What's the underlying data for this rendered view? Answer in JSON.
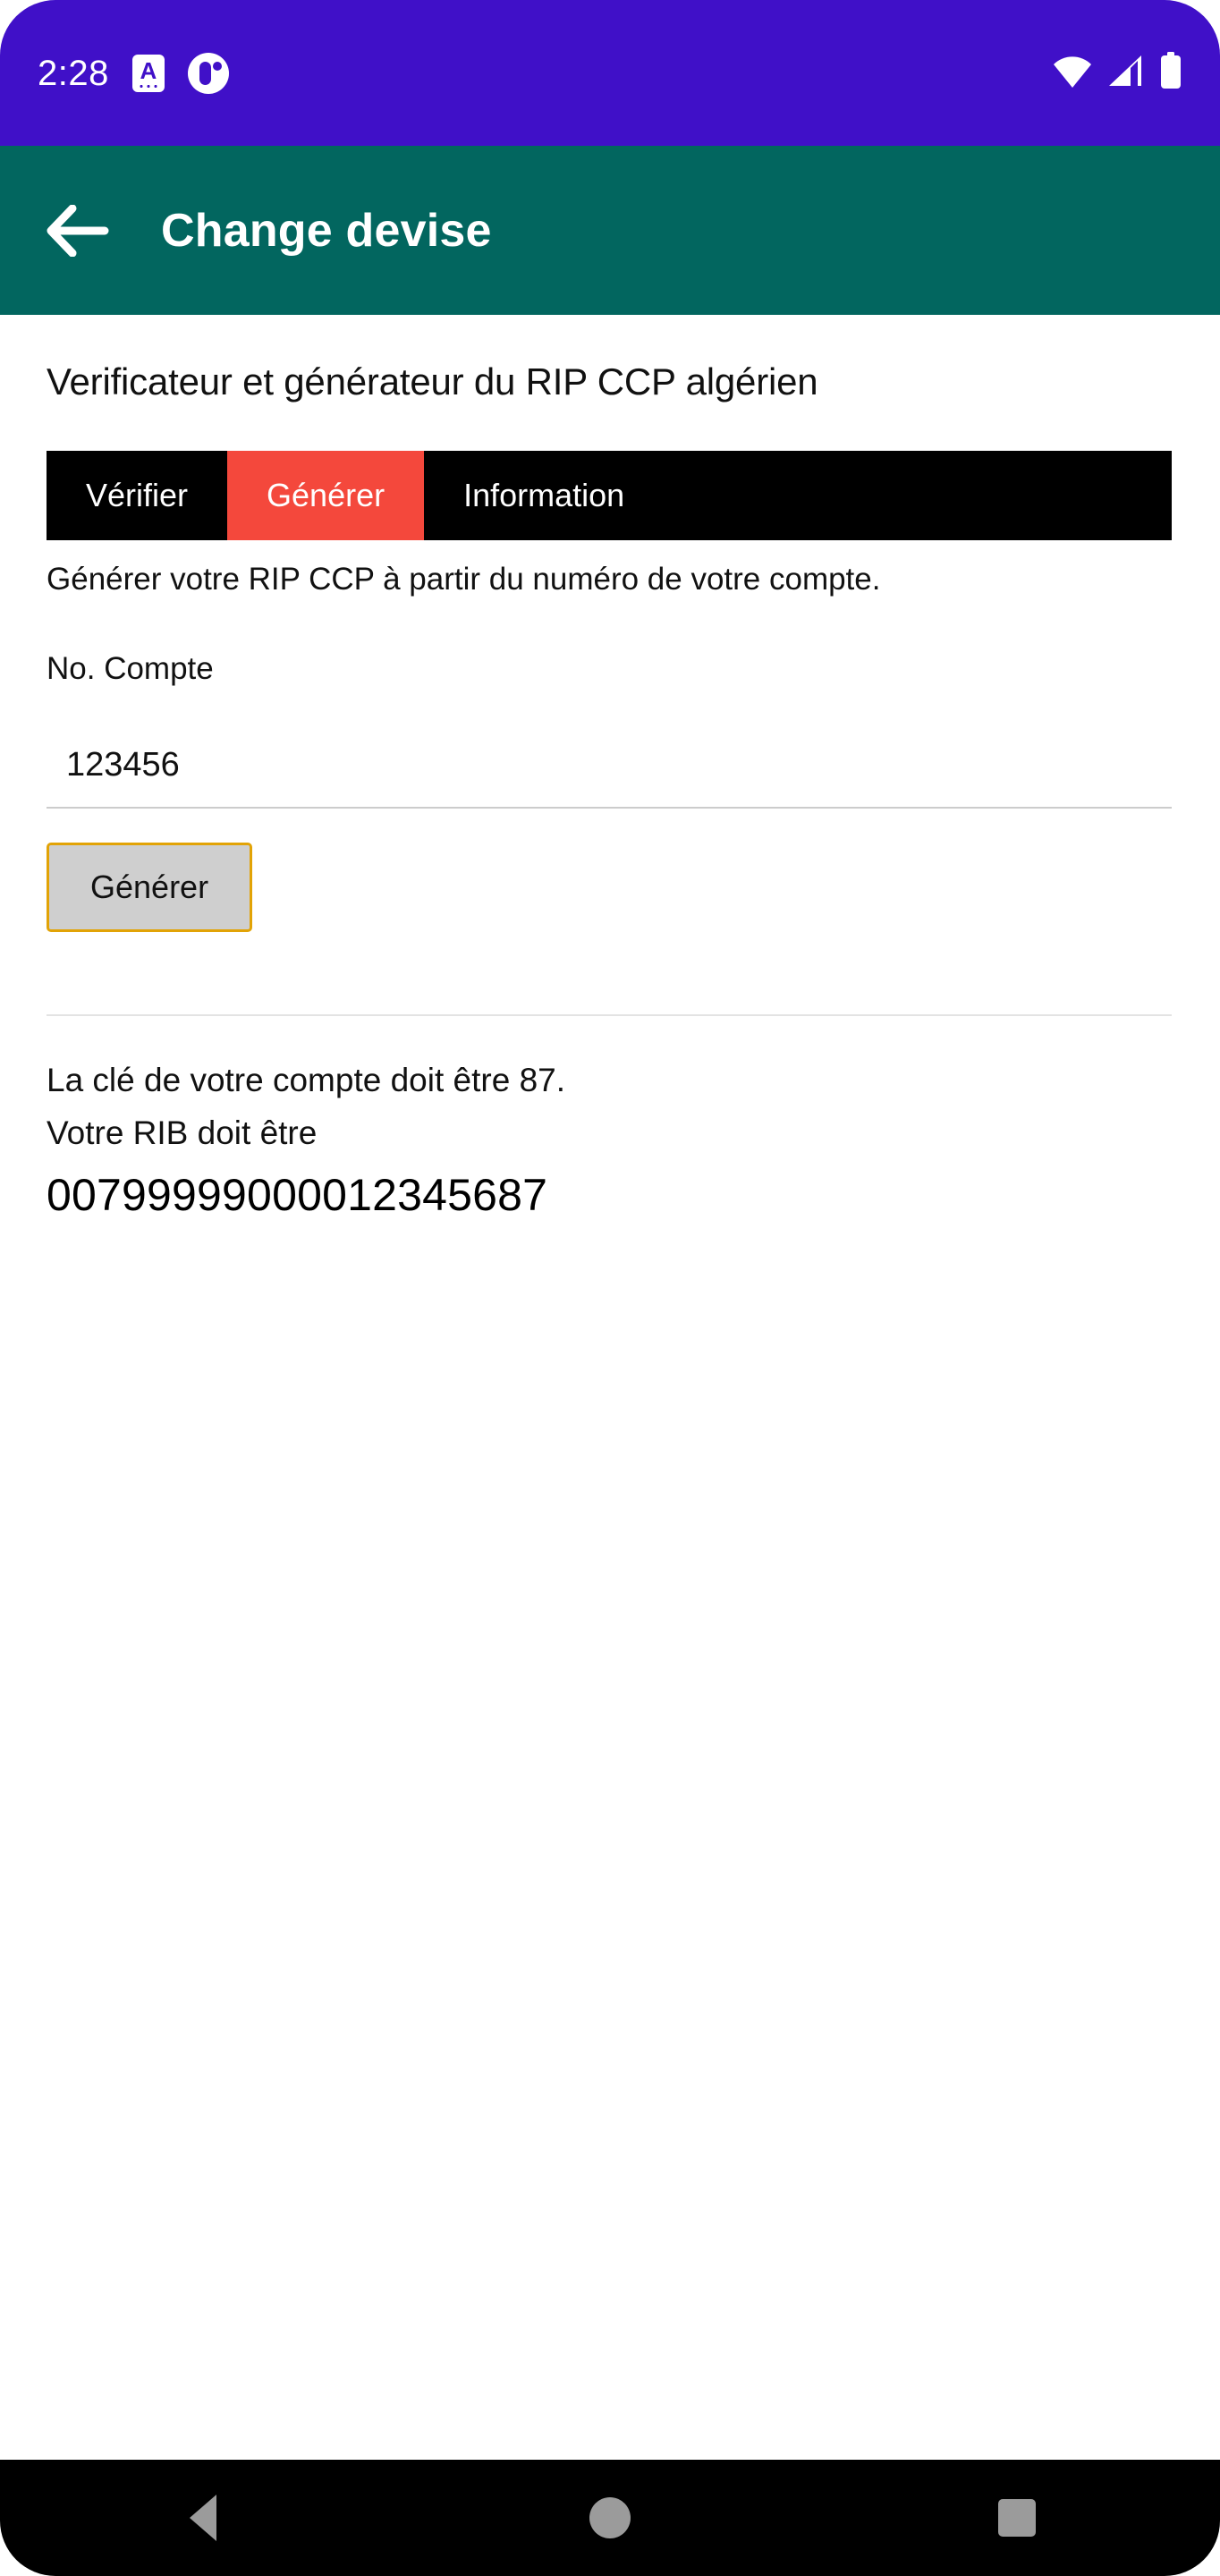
{
  "status_bar": {
    "time": "2:28",
    "left_icons": [
      {
        "name": "language-a-icon",
        "glyph": "A"
      },
      {
        "name": "app-badge-icon",
        "glyph": ""
      }
    ],
    "right_icons": [
      {
        "name": "wifi-icon"
      },
      {
        "name": "cellular-signal-icon"
      },
      {
        "name": "battery-icon"
      }
    ],
    "background_color": "#4010c8"
  },
  "app_bar": {
    "back_label": "back-arrow",
    "title": "Change devise",
    "background_color": "#02665f"
  },
  "main": {
    "heading": "Verificateur et générateur du RIP CCP algérien",
    "tabs": [
      {
        "label": "Vérifier",
        "active": false
      },
      {
        "label": "Générer",
        "active": true
      },
      {
        "label": "Information",
        "active": false
      }
    ],
    "tab_active_color": "#f4483c",
    "tab_bar_color": "#000000",
    "tab_description": "Générer votre RIP CCP à partir du numéro de votre compte.",
    "form": {
      "account_label": "No. Compte",
      "account_value": "123456",
      "account_placeholder": "",
      "submit_label": "Générer",
      "submit_border_color": "#e2a306",
      "submit_background_color": "#cfcfcf"
    },
    "result": {
      "key_line": "La clé de votre compte doit être 87.",
      "rib_label": "Votre RIB doit être",
      "rib_value": "00799999000012345687"
    }
  },
  "nav_bar": {
    "buttons": [
      {
        "name": "nav-back",
        "label": "back-triangle"
      },
      {
        "name": "nav-home",
        "label": "home-circle"
      },
      {
        "name": "nav-recents",
        "label": "recents-square"
      }
    ],
    "background_color": "#000000"
  }
}
